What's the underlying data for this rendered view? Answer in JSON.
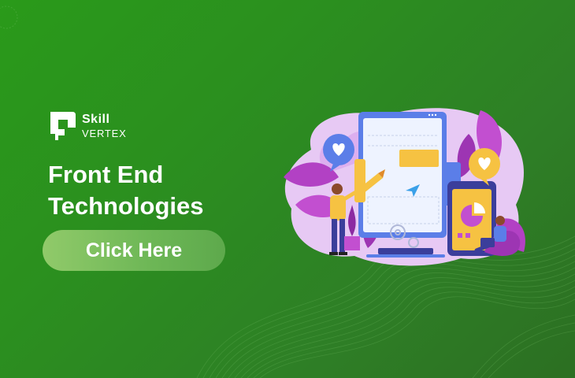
{
  "brand": {
    "name_line1": "Skill",
    "name_line2": "VERTEX"
  },
  "headline": {
    "line1": "Front End",
    "line2": "Technologies"
  },
  "cta": {
    "label": "Click Here"
  },
  "colors": {
    "background": "#2b8f1f",
    "text": "#ffffff",
    "button": "#8cc86a",
    "accent_purple": "#c24fd0",
    "accent_yellow": "#f6c242",
    "accent_blue": "#5b7ee8"
  },
  "illustration": {
    "description_icons": [
      "heart-bubble-icon",
      "pie-chart-icon",
      "paper-plane-icon",
      "gear-icon"
    ]
  }
}
